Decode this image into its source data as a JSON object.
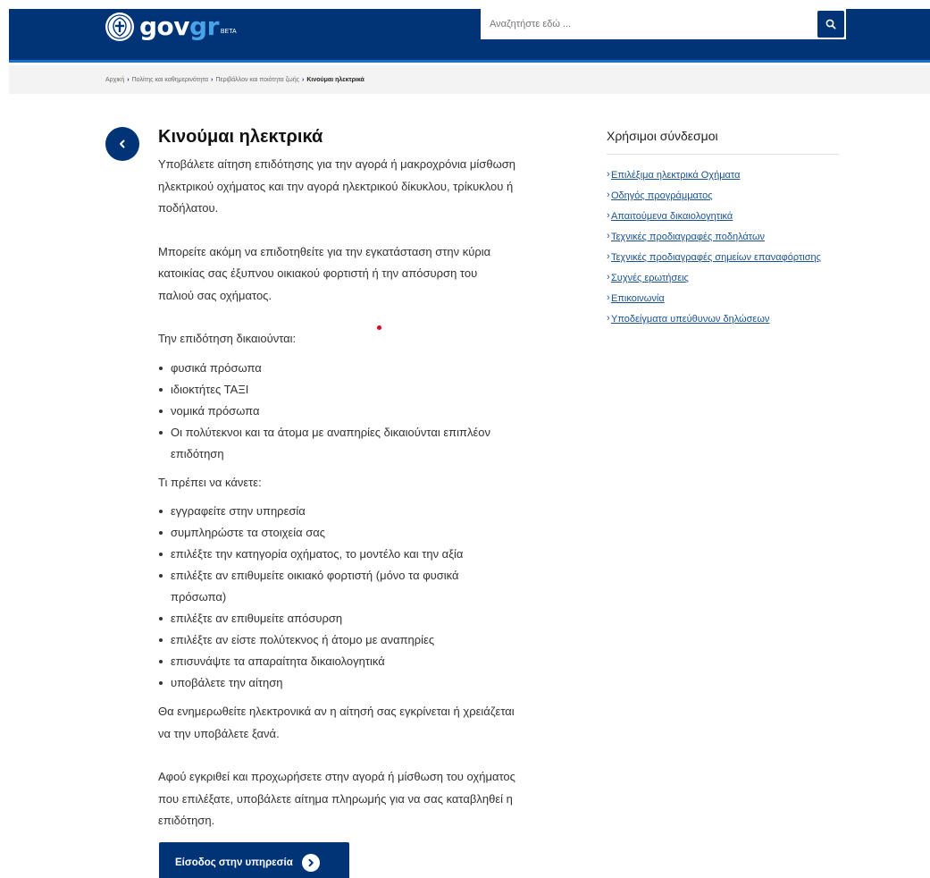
{
  "header": {
    "logo_main": "gov",
    "logo_accent": "gr",
    "logo_badge": "BETA",
    "search_placeholder": "Αναζητήστε εδώ ..."
  },
  "breadcrumb": [
    {
      "label": "Αρχική"
    },
    {
      "label": "Πολίτης και καθημερινότητα"
    },
    {
      "label": "Περιβάλλον και ποιότητα ζωής"
    },
    {
      "label": "Κινούμαι ηλεκτρικά",
      "current": true
    }
  ],
  "main": {
    "title": "Κινούμαι ηλεκτρικά",
    "intro": "Υποβάλετε αίτηση επιδότησης για την αγορά ή μακροχρόνια μίσθωση ηλεκτρικού οχήματος και την αγορά ηλεκτρικού δίκυκλου, τρίκυκλου ή ποδήλατου.",
    "intro2": "Μπορείτε ακόμη να επιδοτηθείτε για την εγκατάσταση στην κύρια κατοικίας σας έξυπνου οικιακού φορτιστή ή την απόσυρση του παλιού σας οχήματος.",
    "eligible_heading": "Την επιδότηση δικαιούνται:",
    "eligible": [
      "φυσικά πρόσωπα",
      "ιδιοκτήτες ΤΑΞΙ",
      "νομικά πρόσωπα",
      "Οι πολύτεκνοι και τα άτομα με αναπηρίες δικαιούνται επιπλέον επιδότηση"
    ],
    "steps_heading": "Τι πρέπει να κάνετε:",
    "steps": [
      "εγγραφείτε στην υπηρεσία",
      "συμπληρώστε τα στοιχεία σας",
      "επιλέξτε την κατηγορία οχήματος, το μοντέλο και την αξία",
      "επιλέξτε αν επιθυμείτε οικιακό φορτιστή (μόνο τα φυσικά πρόσωπα)",
      "επιλέξτε αν επιθυμείτε απόσυρση",
      "επιλέξτε αν είστε πολύτεκνος ή άτομο με αναπηρίες",
      "επισυνάψτε τα απαραίτητα δικαιολογητικά",
      "υποβάλετε την αίτηση"
    ],
    "notice": "Θα ενημερωθείτε ηλεκτρονικά αν η αίτησή σας εγκρίνεται ή χρειάζεται να την υποβάλετε ξανά.",
    "payment": "Αφού εγκριθεί και προχωρήσετε στην αγορά ή μίσθωση του οχήματος που επιλέξατε, υποβάλετε αίτημα πληρωμής για να σας καταβληθεί η επιδότηση.",
    "cta_label": "Είσοδος στην υπηρεσία"
  },
  "aside": {
    "title": "Χρήσιμοι σύνδεσμοι",
    "links": [
      "Επιλέξιμα ηλεκτρικά Οχήματα",
      "Οδηγός προγράμματος",
      "Απαιτούμενα δικαιολογητικά",
      "Τεχνικές προδιαγραφές ποδηλάτων",
      "Τεχνικές προδιαγραφές σημείων επαναφόρτισης",
      "Συχνές ερωτήσεις",
      "Επικοινωνία",
      "Υποδείγματα υπεύθυνων δηλώσεων"
    ]
  },
  "colors": {
    "brand_navy": "#003476",
    "link_blue": "#1a5296",
    "accent_red": "#e0001b"
  }
}
